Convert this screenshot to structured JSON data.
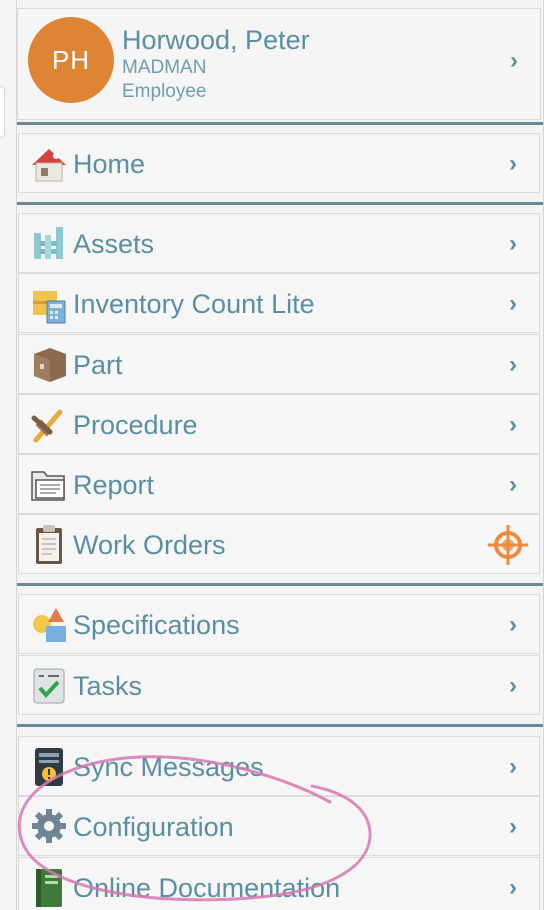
{
  "profile": {
    "initials": "PH",
    "name": "Horwood, Peter",
    "code": "MADMAN",
    "role": "Employee",
    "chevron": "›",
    "avatar_color": "#df8434"
  },
  "menu": {
    "chevron": "›",
    "home": {
      "label": "Home",
      "icon": "home-icon"
    },
    "assets": {
      "label": "Assets",
      "icon": "assets-icon"
    },
    "inventory": {
      "label": "Inventory Count Lite",
      "icon": "inventory-count-icon"
    },
    "part": {
      "label": "Part",
      "icon": "part-box-icon"
    },
    "procedure": {
      "label": "Procedure",
      "icon": "procedure-tools-icon"
    },
    "report": {
      "label": "Report",
      "icon": "report-folder-icon"
    },
    "work_orders": {
      "label": "Work Orders",
      "icon": "clipboard-icon",
      "indicator": "target-icon"
    },
    "specifications": {
      "label": "Specifications",
      "icon": "shapes-icon"
    },
    "tasks": {
      "label": "Tasks",
      "icon": "task-check-icon"
    },
    "sync_messages": {
      "label": "Sync Messages",
      "icon": "sync-device-icon"
    },
    "configuration": {
      "label": "Configuration",
      "icon": "gear-icon"
    },
    "online_documentation": {
      "label": "Online Documentation",
      "icon": "book-icon"
    }
  },
  "colors": {
    "text": "#5a8fa3",
    "separator": "#6a8898",
    "annotation": "#d678b2",
    "work_orders_indicator": "#ef8a3c"
  }
}
